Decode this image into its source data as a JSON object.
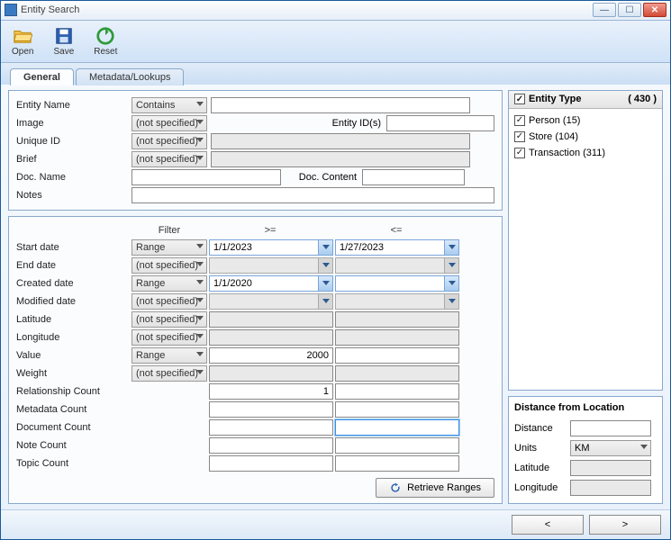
{
  "window": {
    "title": "Entity Search"
  },
  "toolbar": {
    "open": "Open",
    "save": "Save",
    "reset": "Reset"
  },
  "tabs": {
    "general": "General",
    "lookups": "Metadata/Lookups"
  },
  "form": {
    "entity_name_lbl": "Entity Name",
    "entity_name_filter": "Contains",
    "entity_name_val": "",
    "image_lbl": "Image",
    "image_filter": "(not specified)",
    "entity_ids_lbl": "Entity ID(s)",
    "entity_ids_val": "",
    "unique_id_lbl": "Unique ID",
    "unique_id_filter": "(not specified)",
    "unique_id_val": "",
    "brief_lbl": "Brief",
    "brief_filter": "(not specified)",
    "brief_val": "",
    "doc_name_lbl": "Doc. Name",
    "doc_name_val": "",
    "doc_content_lbl": "Doc. Content",
    "doc_content_val": "",
    "notes_lbl": "Notes",
    "notes_val": ""
  },
  "range": {
    "hdr_filter": "Filter",
    "hdr_ge": ">=",
    "hdr_le": "<=",
    "rows": {
      "start_date": {
        "label": "Start date",
        "filter": "Range",
        "ge": "1/1/2023",
        "le": "1/27/2023",
        "type": "date",
        "enabled": true
      },
      "end_date": {
        "label": "End date",
        "filter": "(not specified)",
        "ge": "",
        "le": "",
        "type": "date",
        "enabled": false
      },
      "created_date": {
        "label": "Created date",
        "filter": "Range",
        "ge": "1/1/2020",
        "le": "",
        "type": "date",
        "enabled": true
      },
      "modified_date": {
        "label": "Modified date",
        "filter": "(not specified)",
        "ge": "",
        "le": "",
        "type": "date",
        "enabled": false
      },
      "latitude": {
        "label": "Latitude",
        "filter": "(not specified)",
        "ge": "",
        "le": "",
        "type": "num",
        "enabled": false
      },
      "longitude": {
        "label": "Longitude",
        "filter": "(not specified)",
        "ge": "",
        "le": "",
        "type": "num",
        "enabled": false
      },
      "value": {
        "label": "Value",
        "filter": "Range",
        "ge": "2000",
        "le": "",
        "type": "num",
        "enabled": true
      },
      "weight": {
        "label": "Weight",
        "filter": "(not specified)",
        "ge": "",
        "le": "",
        "type": "num",
        "enabled": false
      },
      "rel_count": {
        "label": "Relationship Count",
        "filter": "",
        "ge": "1",
        "le": "",
        "type": "plain"
      },
      "meta_count": {
        "label": "Metadata Count",
        "filter": "",
        "ge": "",
        "le": "",
        "type": "plain"
      },
      "doc_count": {
        "label": "Document Count",
        "filter": "",
        "ge": "",
        "le": "",
        "type": "plain",
        "le_focus": true
      },
      "note_count": {
        "label": "Note Count",
        "filter": "",
        "ge": "",
        "le": "",
        "type": "plain"
      },
      "topic_count": {
        "label": "Topic Count",
        "filter": "",
        "ge": "",
        "le": "",
        "type": "plain"
      }
    },
    "retrieve_btn": "Retrieve Ranges"
  },
  "entity_type": {
    "title": "Entity Type",
    "count": "( 430 )",
    "items": [
      {
        "label": "Person (15)",
        "checked": true
      },
      {
        "label": "Store (104)",
        "checked": true
      },
      {
        "label": "Transaction (311)",
        "checked": true
      }
    ]
  },
  "distance": {
    "title": "Distance from Location",
    "distance_lbl": "Distance",
    "distance_val": "",
    "units_lbl": "Units",
    "units_val": "KM",
    "lat_lbl": "Latitude",
    "lat_val": "",
    "lon_lbl": "Longitude",
    "lon_val": ""
  },
  "footer": {
    "prev": "<",
    "next": ">"
  }
}
